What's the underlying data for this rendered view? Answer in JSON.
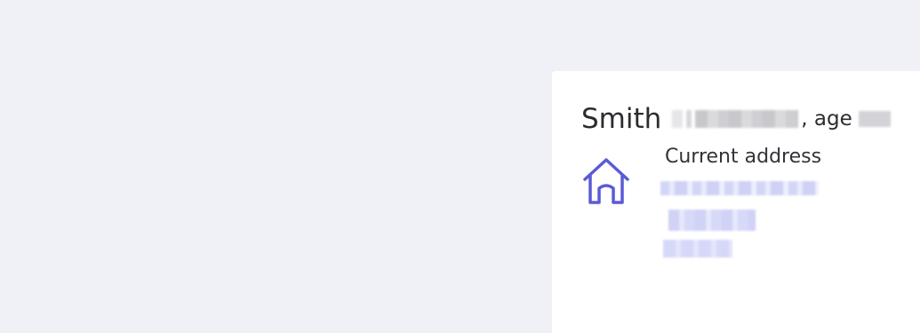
{
  "person": {
    "surname": "Smith",
    "age_prefix": ", age",
    "address_label": "Current address"
  },
  "icons": {
    "address": "house-icon"
  },
  "colors": {
    "background": "#f0f1f6",
    "card": "#ffffff",
    "accent": "#5b5bd6",
    "text": "#2c2c30"
  }
}
